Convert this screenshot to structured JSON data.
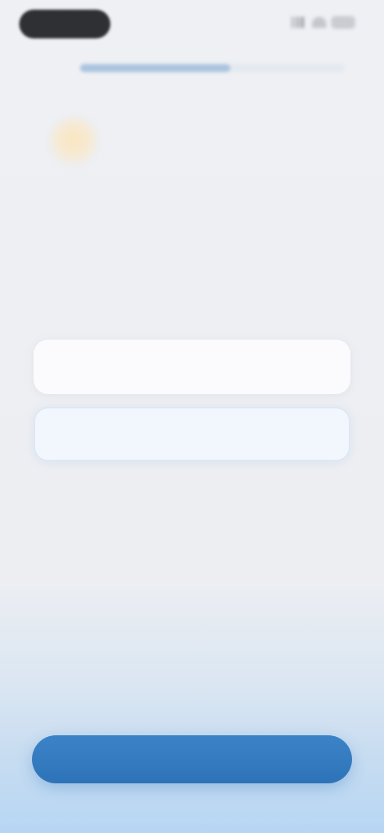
{
  "status_bar": {
    "time": "",
    "icons": [
      "cellular-signal-icon",
      "wifi-icon",
      "battery-icon"
    ]
  },
  "progress": {
    "value": 0.57
  },
  "question": {
    "emoji_icon": "emoji-icon",
    "title": ""
  },
  "options": [
    {
      "label": ""
    },
    {
      "label": ""
    }
  ],
  "continue_button": {
    "label": ""
  },
  "colors": {
    "accent": "#2e73b8",
    "progress_fill": "#aac4df",
    "background": "#eceef2",
    "selected_option": "#f2f7fd"
  }
}
